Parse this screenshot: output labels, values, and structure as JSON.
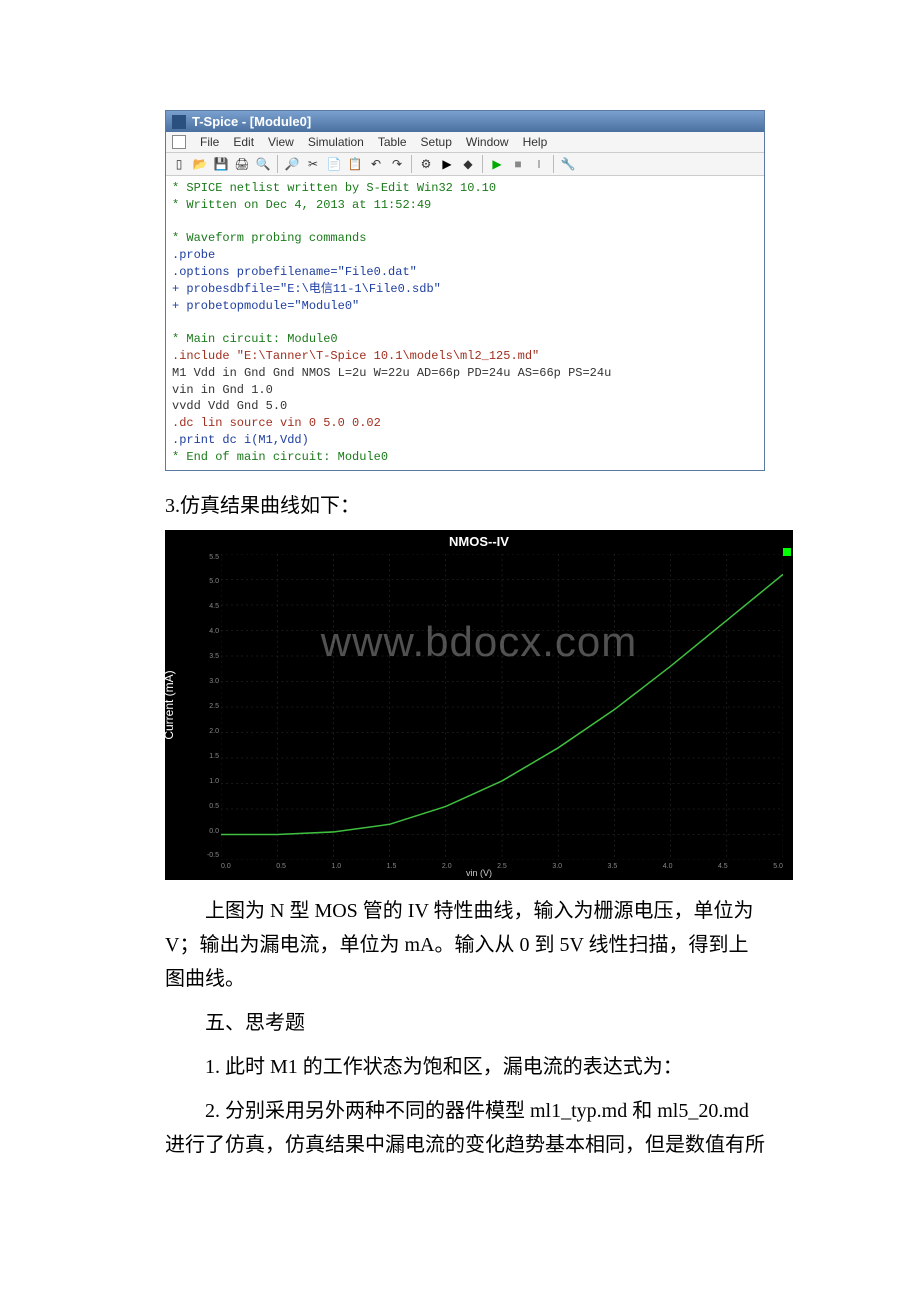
{
  "tspice": {
    "title": "T-Spice - [Module0]",
    "menus": [
      "File",
      "Edit",
      "View",
      "Simulation",
      "Table",
      "Setup",
      "Window",
      "Help"
    ],
    "code_lines": [
      {
        "text": "* SPICE netlist written by S-Edit Win32 10.10",
        "cls": "kw-green"
      },
      {
        "text": "* Written on Dec 4, 2013 at 11:52:49",
        "cls": "kw-green"
      },
      {
        "text": "",
        "cls": ""
      },
      {
        "text": "* Waveform probing commands",
        "cls": "kw-green"
      },
      {
        "text": ".probe",
        "cls": "kw-blue"
      },
      {
        "text": ".options probefilename=\"File0.dat\"",
        "cls": "kw-blue"
      },
      {
        "text": "+ probesdbfile=\"E:\\电信11-1\\File0.sdb\"",
        "cls": "kw-blue"
      },
      {
        "text": "+ probetopmodule=\"Module0\"",
        "cls": "kw-blue"
      },
      {
        "text": "",
        "cls": ""
      },
      {
        "text": "* Main circuit: Module0",
        "cls": "kw-green"
      },
      {
        "text": ".include \"E:\\Tanner\\T-Spice 10.1\\models\\ml2_125.md\"",
        "cls": "kw-red"
      },
      {
        "text": "M1 Vdd in Gnd Gnd NMOS L=2u W=22u AD=66p PD=24u AS=66p PS=24u",
        "cls": ""
      },
      {
        "text": "vin in Gnd 1.0",
        "cls": ""
      },
      {
        "text": "vvdd Vdd Gnd 5.0",
        "cls": ""
      },
      {
        "text": ".dc lin source vin 0 5.0 0.02",
        "cls": "kw-red"
      },
      {
        "text": ".print dc i(M1,Vdd)",
        "cls": "kw-blue"
      },
      {
        "text": "* End of main circuit: Module0",
        "cls": "kw-green"
      }
    ]
  },
  "caption_3": "3.仿真结果曲线如下：",
  "chart_data": {
    "type": "line",
    "title": "NMOS--IV",
    "xlabel": "vin (V)",
    "ylabel": "Current (mA)",
    "xlim": [
      0,
      5.0
    ],
    "ylim": [
      -0.5,
      5.5
    ],
    "x_ticks": [
      "0.0",
      "0.5",
      "1.0",
      "1.5",
      "2.0",
      "2.5",
      "3.0",
      "3.5",
      "4.0",
      "4.5",
      "5.0"
    ],
    "y_ticks": [
      "-0.5",
      "0.0",
      "0.5",
      "1.0",
      "1.5",
      "2.0",
      "2.5",
      "3.0",
      "3.5",
      "4.0",
      "4.5",
      "5.0",
      "5.5"
    ],
    "series": [
      {
        "name": "i(M1,Vdd)",
        "color": "#3fbf3f",
        "x": [
          0.0,
          0.5,
          1.0,
          1.5,
          2.0,
          2.5,
          3.0,
          3.5,
          4.0,
          4.5,
          5.0
        ],
        "y": [
          0.0,
          0.0,
          0.05,
          0.2,
          0.55,
          1.05,
          1.7,
          2.45,
          3.3,
          4.2,
          5.1
        ]
      }
    ]
  },
  "watermark": "www.bdocx.com",
  "para1": "上图为 N 型 MOS 管的 IV 特性曲线，输入为栅源电压，单位为 V；输出为漏电流，单位为 mA。输入从 0 到 5V 线性扫描，得到上图曲线。",
  "heading5": "五、思考题",
  "q1": "1. 此时 M1 的工作状态为饱和区，漏电流的表达式为：",
  "q2": "2. 分别采用另外两种不同的器件模型 ml1_typ.md 和 ml5_20.md 进行了仿真，仿真结果中漏电流的变化趋势基本相同，但是数值有所"
}
